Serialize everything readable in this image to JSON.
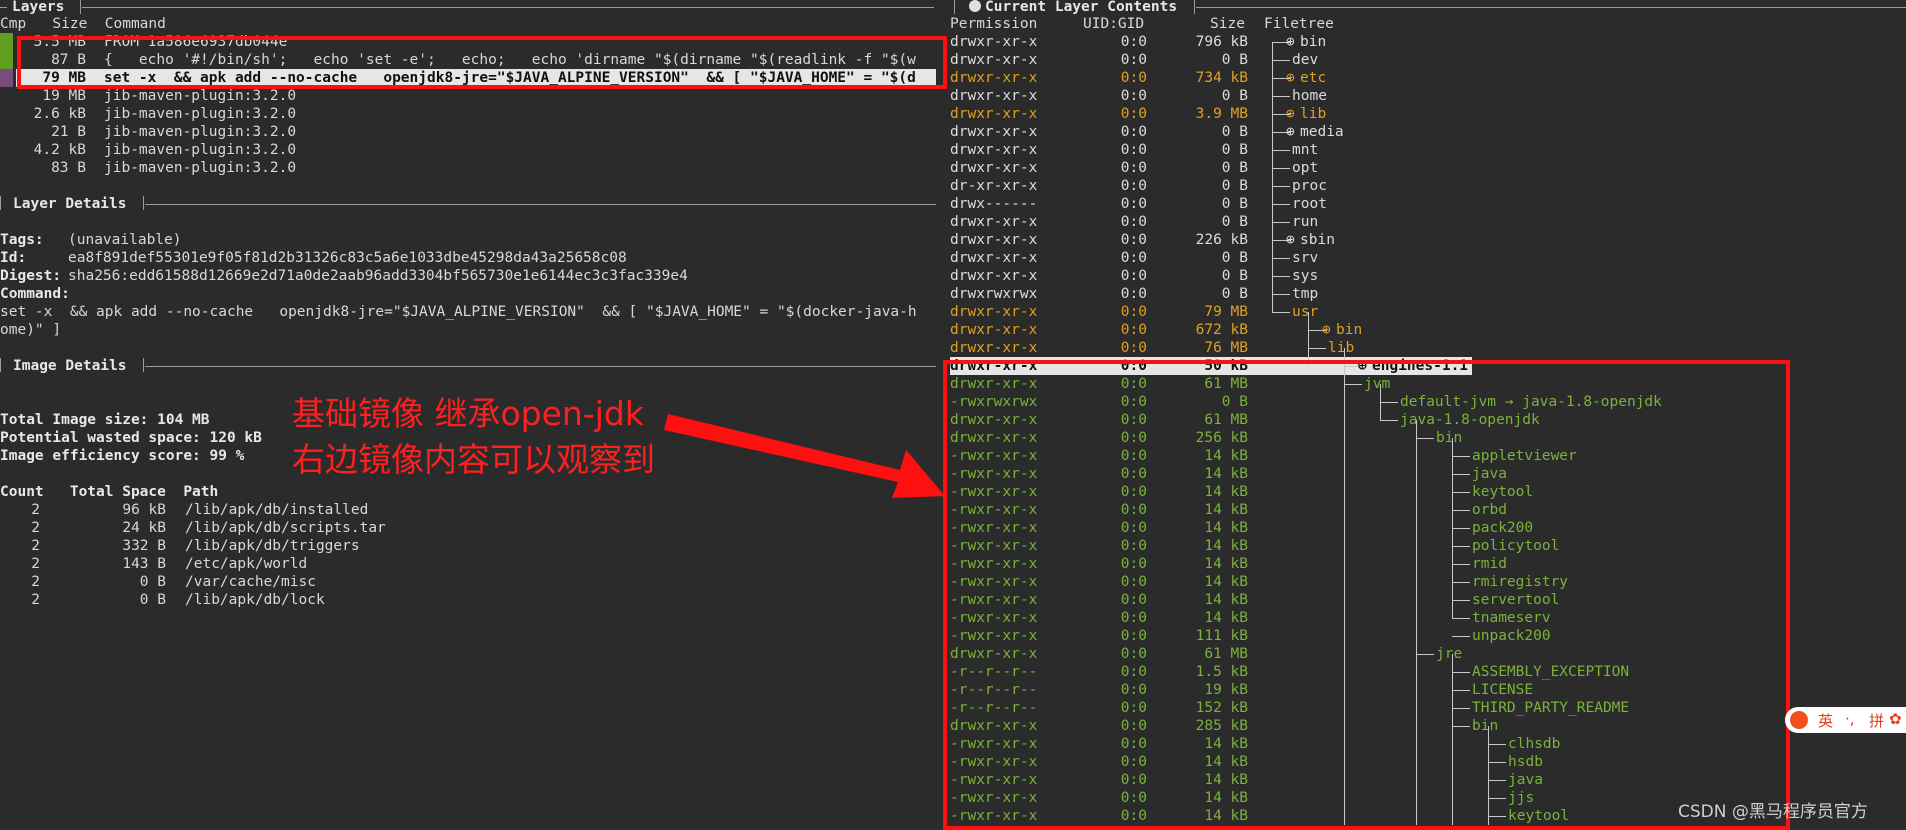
{
  "layers": {
    "title": "Layers",
    "header": "Cmp   Size  Command",
    "rows": [
      {
        "size": "5.5 MB",
        "command": "FROM 1a586e6937db044e"
      },
      {
        "size": "87 B",
        "command": "{   echo '#!/bin/sh';   echo 'set -e';   echo;   echo 'dirname \"$(dirname \"$(readlink -f \"$(w"
      },
      {
        "size": "79 MB",
        "command": "set -x  && apk add --no-cache   openjdk8-jre=\"$JAVA_ALPINE_VERSION\"  && [ \"$JAVA_HOME\" = \"$(d"
      },
      {
        "size": "19 MB",
        "command": "jib-maven-plugin:3.2.0"
      },
      {
        "size": "2.6 kB",
        "command": "jib-maven-plugin:3.2.0"
      },
      {
        "size": "21 B",
        "command": "jib-maven-plugin:3.2.0"
      },
      {
        "size": "4.2 kB",
        "command": "jib-maven-plugin:3.2.0"
      },
      {
        "size": "83 B",
        "command": "jib-maven-plugin:3.2.0"
      }
    ]
  },
  "layer_details": {
    "title": "Layer Details",
    "tags_label": "Tags:",
    "tags": "(unavailable)",
    "id_label": "Id:",
    "id": "ea8f891def55301e9f05f81d2b31326c83c5a6e1033dbe45298da43a25658c08",
    "digest_label": "Digest:",
    "digest": "sha256:edd61588d12669e2d71a0de2aab96add3304bf565730e1e6144ec3c3fac339e4",
    "command_label": "Command:",
    "command_line1": "set -x  && apk add --no-cache   openjdk8-jre=\"$JAVA_ALPINE_VERSION\"  && [ \"$JAVA_HOME\" = \"$(docker-java-h",
    "command_line2": "ome)\" ]"
  },
  "image_details": {
    "title": "Image Details",
    "total_size": "Total Image size: 104 MB",
    "wasted": "Potential wasted space: 120 kB",
    "efficiency": "Image efficiency score: 99 %",
    "table_header": "Count   Total Space  Path",
    "rows": [
      {
        "count": "2",
        "space": "96 kB",
        "path": "/lib/apk/db/installed"
      },
      {
        "count": "2",
        "space": "24 kB",
        "path": "/lib/apk/db/scripts.tar"
      },
      {
        "count": "2",
        "space": "332 B",
        "path": "/lib/apk/db/triggers"
      },
      {
        "count": "2",
        "space": "143 B",
        "path": "/etc/apk/world"
      },
      {
        "count": "2",
        "space": "0 B",
        "path": "/var/cache/misc"
      },
      {
        "count": "2",
        "space": "0 B",
        "path": "/lib/apk/db/lock"
      }
    ]
  },
  "annotation": {
    "line1": "基础镜像 继承open-jdk",
    "line2": "右边镜像内容可以观察到"
  },
  "contents": {
    "title": "Current Layer Contents",
    "header_perm": "Permission",
    "header_uid": "UID:GID",
    "header_size": "Size",
    "header_tree": "Filetree",
    "rows": [
      {
        "perm": "drwxr-xr-x",
        "uid": "0:0",
        "size": "796 kB",
        "name": "bin",
        "color": "white",
        "depth": 0,
        "plus": true
      },
      {
        "perm": "drwxr-xr-x",
        "uid": "0:0",
        "size": "0 B",
        "name": "dev",
        "color": "white",
        "depth": 0,
        "plus": false
      },
      {
        "perm": "drwxr-xr-x",
        "uid": "0:0",
        "size": "734 kB",
        "name": "etc",
        "color": "orange",
        "depth": 0,
        "plus": true
      },
      {
        "perm": "drwxr-xr-x",
        "uid": "0:0",
        "size": "0 B",
        "name": "home",
        "color": "white",
        "depth": 0,
        "plus": false
      },
      {
        "perm": "drwxr-xr-x",
        "uid": "0:0",
        "size": "3.9 MB",
        "name": "lib",
        "color": "orange",
        "depth": 0,
        "plus": true
      },
      {
        "perm": "drwxr-xr-x",
        "uid": "0:0",
        "size": "0 B",
        "name": "media",
        "color": "white",
        "depth": 0,
        "plus": true
      },
      {
        "perm": "drwxr-xr-x",
        "uid": "0:0",
        "size": "0 B",
        "name": "mnt",
        "color": "white",
        "depth": 0,
        "plus": false
      },
      {
        "perm": "drwxr-xr-x",
        "uid": "0:0",
        "size": "0 B",
        "name": "opt",
        "color": "white",
        "depth": 0,
        "plus": false
      },
      {
        "perm": "dr-xr-xr-x",
        "uid": "0:0",
        "size": "0 B",
        "name": "proc",
        "color": "white",
        "depth": 0,
        "plus": false
      },
      {
        "perm": "drwx------",
        "uid": "0:0",
        "size": "0 B",
        "name": "root",
        "color": "white",
        "depth": 0,
        "plus": false
      },
      {
        "perm": "drwxr-xr-x",
        "uid": "0:0",
        "size": "0 B",
        "name": "run",
        "color": "white",
        "depth": 0,
        "plus": false
      },
      {
        "perm": "drwxr-xr-x",
        "uid": "0:0",
        "size": "226 kB",
        "name": "sbin",
        "color": "white",
        "depth": 0,
        "plus": true
      },
      {
        "perm": "drwxr-xr-x",
        "uid": "0:0",
        "size": "0 B",
        "name": "srv",
        "color": "white",
        "depth": 0,
        "plus": false
      },
      {
        "perm": "drwxr-xr-x",
        "uid": "0:0",
        "size": "0 B",
        "name": "sys",
        "color": "white",
        "depth": 0,
        "plus": false
      },
      {
        "perm": "drwxrwxrwx",
        "uid": "0:0",
        "size": "0 B",
        "name": "tmp",
        "color": "white",
        "depth": 0,
        "plus": false
      },
      {
        "perm": "drwxr-xr-x",
        "uid": "0:0",
        "size": "79 MB",
        "name": "usr",
        "color": "orange",
        "depth": 0,
        "plus": false
      },
      {
        "perm": "drwxr-xr-x",
        "uid": "0:0",
        "size": "672 kB",
        "name": "bin",
        "color": "orange",
        "depth": 1,
        "plus": true
      },
      {
        "perm": "drwxr-xr-x",
        "uid": "0:0",
        "size": "76 MB",
        "name": "lib",
        "color": "orange",
        "depth": 1,
        "plus": false
      },
      {
        "perm": "drwxr-xr-x",
        "uid": "0:0",
        "size": "50 kB",
        "name": "engines-1.1",
        "color": "sel",
        "depth": 2,
        "plus": true
      },
      {
        "perm": "drwxr-xr-x",
        "uid": "0:0",
        "size": "61 MB",
        "name": "jvm",
        "color": "green",
        "depth": 2,
        "plus": false
      },
      {
        "perm": "-rwxrwxrwx",
        "uid": "0:0",
        "size": "0 B",
        "name": "default-jvm → java-1.8-openjdk",
        "color": "green",
        "depth": 3,
        "plus": false
      },
      {
        "perm": "drwxr-xr-x",
        "uid": "0:0",
        "size": "61 MB",
        "name": "java-1.8-openjdk",
        "color": "green",
        "depth": 3,
        "plus": false
      },
      {
        "perm": "drwxr-xr-x",
        "uid": "0:0",
        "size": "256 kB",
        "name": "bin",
        "color": "green",
        "depth": 4,
        "plus": false
      },
      {
        "perm": "-rwxr-xr-x",
        "uid": "0:0",
        "size": "14 kB",
        "name": "appletviewer",
        "color": "green",
        "depth": 5,
        "plus": false
      },
      {
        "perm": "-rwxr-xr-x",
        "uid": "0:0",
        "size": "14 kB",
        "name": "java",
        "color": "green",
        "depth": 5,
        "plus": false
      },
      {
        "perm": "-rwxr-xr-x",
        "uid": "0:0",
        "size": "14 kB",
        "name": "keytool",
        "color": "green",
        "depth": 5,
        "plus": false
      },
      {
        "perm": "-rwxr-xr-x",
        "uid": "0:0",
        "size": "14 kB",
        "name": "orbd",
        "color": "green",
        "depth": 5,
        "plus": false
      },
      {
        "perm": "-rwxr-xr-x",
        "uid": "0:0",
        "size": "14 kB",
        "name": "pack200",
        "color": "green",
        "depth": 5,
        "plus": false
      },
      {
        "perm": "-rwxr-xr-x",
        "uid": "0:0",
        "size": "14 kB",
        "name": "policytool",
        "color": "green",
        "depth": 5,
        "plus": false
      },
      {
        "perm": "-rwxr-xr-x",
        "uid": "0:0",
        "size": "14 kB",
        "name": "rmid",
        "color": "green",
        "depth": 5,
        "plus": false
      },
      {
        "perm": "-rwxr-xr-x",
        "uid": "0:0",
        "size": "14 kB",
        "name": "rmiregistry",
        "color": "green",
        "depth": 5,
        "plus": false
      },
      {
        "perm": "-rwxr-xr-x",
        "uid": "0:0",
        "size": "14 kB",
        "name": "servertool",
        "color": "green",
        "depth": 5,
        "plus": false
      },
      {
        "perm": "-rwxr-xr-x",
        "uid": "0:0",
        "size": "14 kB",
        "name": "tnameserv",
        "color": "green",
        "depth": 5,
        "plus": false
      },
      {
        "perm": "-rwxr-xr-x",
        "uid": "0:0",
        "size": "111 kB",
        "name": "unpack200",
        "color": "green",
        "depth": 5,
        "plus": false
      },
      {
        "perm": "drwxr-xr-x",
        "uid": "0:0",
        "size": "61 MB",
        "name": "jre",
        "color": "green",
        "depth": 4,
        "plus": false
      },
      {
        "perm": "-r--r--r--",
        "uid": "0:0",
        "size": "1.5 kB",
        "name": "ASSEMBLY_EXCEPTION",
        "color": "green",
        "depth": 5,
        "plus": false
      },
      {
        "perm": "-r--r--r--",
        "uid": "0:0",
        "size": "19 kB",
        "name": "LICENSE",
        "color": "green",
        "depth": 5,
        "plus": false
      },
      {
        "perm": "-r--r--r--",
        "uid": "0:0",
        "size": "152 kB",
        "name": "THIRD_PARTY_README",
        "color": "green",
        "depth": 5,
        "plus": false
      },
      {
        "perm": "drwxr-xr-x",
        "uid": "0:0",
        "size": "285 kB",
        "name": "bin",
        "color": "green",
        "depth": 5,
        "plus": false
      },
      {
        "perm": "-rwxr-xr-x",
        "uid": "0:0",
        "size": "14 kB",
        "name": "clhsdb",
        "color": "green",
        "depth": 6,
        "plus": false
      },
      {
        "perm": "-rwxr-xr-x",
        "uid": "0:0",
        "size": "14 kB",
        "name": "hsdb",
        "color": "green",
        "depth": 6,
        "plus": false
      },
      {
        "perm": "-rwxr-xr-x",
        "uid": "0:0",
        "size": "14 kB",
        "name": "java",
        "color": "green",
        "depth": 6,
        "plus": false
      },
      {
        "perm": "-rwxr-xr-x",
        "uid": "0:0",
        "size": "14 kB",
        "name": "jjs",
        "color": "green",
        "depth": 6,
        "plus": false
      },
      {
        "perm": "-rwxr-xr-x",
        "uid": "0:0",
        "size": "14 kB",
        "name": "keytool",
        "color": "green",
        "depth": 6,
        "plus": false
      }
    ]
  },
  "ime": {
    "lang": "英",
    "dots": "·,",
    "pinyin": "拼"
  },
  "watermark": "CSDN @黑马程序员官方",
  "colors": {
    "red": "#ff1010",
    "green": "#7bb23a",
    "orange": "#e0a020",
    "bg": "#2b2b2b"
  }
}
